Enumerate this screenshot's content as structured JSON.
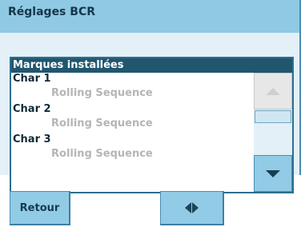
{
  "header": {
    "title": "Réglages BCR"
  },
  "marks_list": {
    "header": "Marques installées",
    "items": [
      {
        "name": "Char 1",
        "sequence": "Rolling Sequence"
      },
      {
        "name": "Char 2",
        "sequence": "Rolling Sequence"
      },
      {
        "name": "Char 3",
        "sequence": "Rolling Sequence"
      }
    ]
  },
  "footer": {
    "back_label": "Retour",
    "left_right_icon": "left-right-arrows-icon"
  },
  "icons": {
    "scroll_up": "triangle-up-icon",
    "scroll_down": "triangle-down-icon"
  },
  "colors": {
    "title_bar": "#8fc9e4",
    "panel": "#e3f0f7",
    "list_header": "#22566f",
    "button": "#92cbe6",
    "disabled_text": "#b5b5b5"
  }
}
